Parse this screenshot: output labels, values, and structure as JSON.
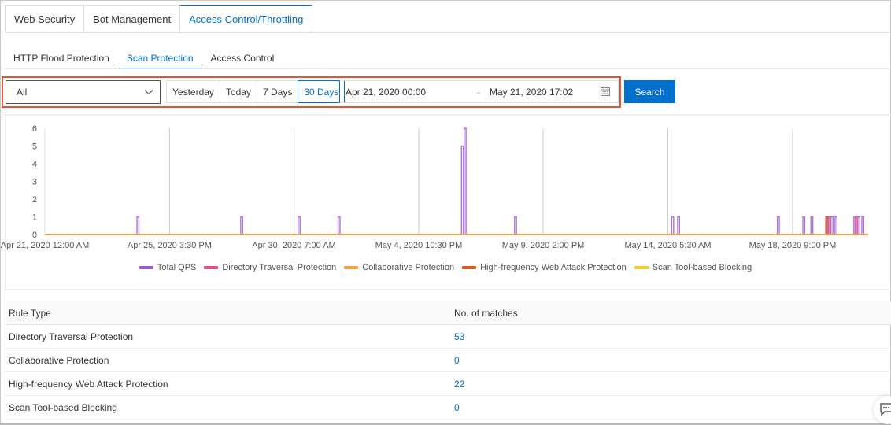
{
  "top_tabs": [
    {
      "label": "Web Security",
      "active": false
    },
    {
      "label": "Bot Management",
      "active": false
    },
    {
      "label": "Access Control/Throttling",
      "active": true
    }
  ],
  "sub_tabs": [
    {
      "label": "HTTP Flood Protection",
      "active": false
    },
    {
      "label": "Scan Protection",
      "active": true
    },
    {
      "label": "Access Control",
      "active": false
    }
  ],
  "filter": {
    "select_value": "All",
    "ranges": [
      {
        "label": "Yesterday",
        "active": false
      },
      {
        "label": "Today",
        "active": false
      },
      {
        "label": "7 Days",
        "active": false
      },
      {
        "label": "30 Days",
        "active": true
      }
    ],
    "start": "Apr 21, 2020 00:00",
    "separator": "-",
    "end": "May 21, 2020 17:02",
    "search_label": "Search",
    "highlight_color": "#e8542f"
  },
  "chart_data": {
    "type": "line",
    "title": "",
    "xlabel": "",
    "ylabel": "",
    "ylim": [
      0,
      6
    ],
    "yticks": [
      "0",
      "1",
      "2",
      "3",
      "4",
      "5",
      "6"
    ],
    "x_range_days": [
      0,
      30.7
    ],
    "xticks": [
      {
        "label": "Apr 21, 2020 12:00 AM",
        "day": 0
      },
      {
        "label": "Apr 25, 2020 3:30 PM",
        "day": 4.65
      },
      {
        "label": "Apr 30, 2020 7:00 AM",
        "day": 9.29
      },
      {
        "label": "May 4, 2020 10:30 PM",
        "day": 13.94
      },
      {
        "label": "May 9, 2020 2:00 PM",
        "day": 18.58
      },
      {
        "label": "May 14, 2020 5:30 AM",
        "day": 23.23
      },
      {
        "label": "May 18, 2020 9:00 PM",
        "day": 27.88
      }
    ],
    "grid": "vertical",
    "series": [
      {
        "name": "Total QPS",
        "color": "#9b59d6",
        "spikes": [
          {
            "day": 3.47,
            "value": 1
          },
          {
            "day": 7.34,
            "value": 1
          },
          {
            "day": 9.48,
            "value": 1
          },
          {
            "day": 10.97,
            "value": 1
          },
          {
            "day": 15.57,
            "value": 5
          },
          {
            "day": 15.67,
            "value": 6
          },
          {
            "day": 17.55,
            "value": 1
          },
          {
            "day": 23.41,
            "value": 1
          },
          {
            "day": 23.63,
            "value": 1
          },
          {
            "day": 27.35,
            "value": 1
          },
          {
            "day": 28.3,
            "value": 1
          },
          {
            "day": 28.6,
            "value": 1
          },
          {
            "day": 29.2,
            "value": 1
          },
          {
            "day": 29.35,
            "value": 1
          },
          {
            "day": 29.5,
            "value": 1
          },
          {
            "day": 30.2,
            "value": 1
          },
          {
            "day": 30.35,
            "value": 1
          },
          {
            "day": 30.5,
            "value": 1
          }
        ]
      },
      {
        "name": "Directory Traversal Protection",
        "color": "#e8508a",
        "spikes": [
          {
            "day": 29.25,
            "value": 1
          },
          {
            "day": 30.25,
            "value": 1
          }
        ]
      },
      {
        "name": "Collaborative Protection",
        "color": "#f5a042",
        "spikes": []
      },
      {
        "name": "High-frequency Web Attack Protection",
        "color": "#e05a24",
        "spikes": [
          {
            "day": 29.15,
            "value": 1
          }
        ]
      },
      {
        "name": "Scan Tool-based Blocking",
        "color": "#f7cb2d",
        "spikes": []
      }
    ],
    "legend_position": "bottom-center"
  },
  "table": {
    "headers": [
      "Rule Type",
      "No. of matches"
    ],
    "rows": [
      {
        "type": "Directory Traversal Protection",
        "count": "53",
        "link": true
      },
      {
        "type": "Collaborative Protection",
        "count": "0",
        "link": true
      },
      {
        "type": "High-frequency Web Attack Protection",
        "count": "22",
        "link": true
      },
      {
        "type": "Scan Tool-based Blocking",
        "count": "0",
        "link": true
      }
    ]
  },
  "icons": {
    "select_chevron": "chevron-down-icon",
    "calendar": "calendar-icon",
    "feedback": "feedback-icon"
  }
}
